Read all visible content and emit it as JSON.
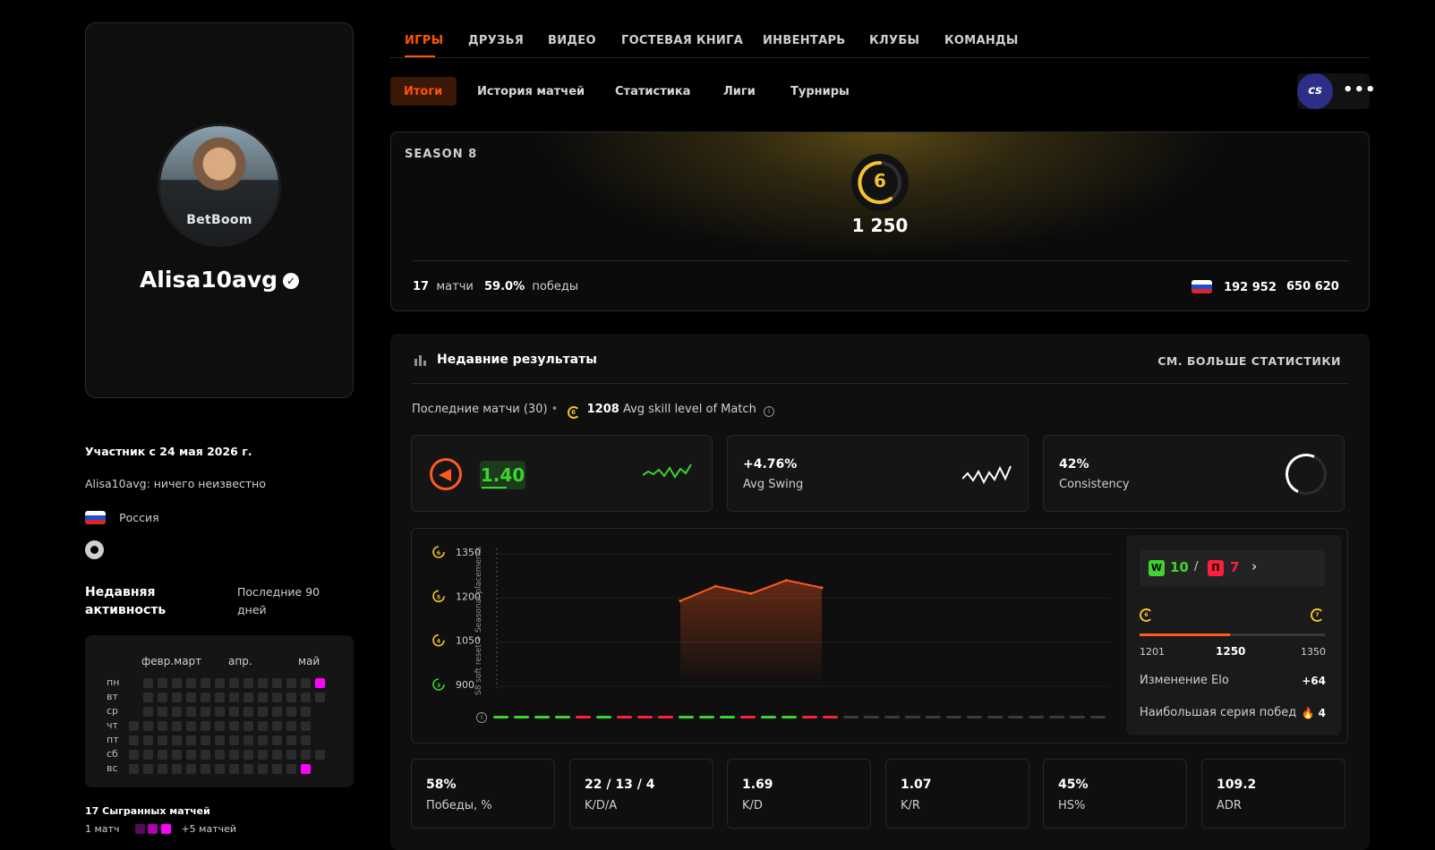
{
  "profile": {
    "username": "Alisa10avg",
    "avatar_shirt_text": "BetBoom",
    "member_since": "Участник с 24 мая 2026 г.",
    "bio": "Alisa10avg: ничего неизвестно",
    "country": "Россия"
  },
  "activity": {
    "title": "Недавняя активность",
    "period": "Последние 90 дней",
    "months": [
      "февр.март",
      "апр.",
      "май"
    ],
    "days": [
      "пн",
      "вт",
      "ср",
      "чт",
      "пт",
      "сб",
      "вс"
    ],
    "matches_played": "17 Сыгранных матчей",
    "legend_min": "1 матч",
    "legend_max": "+5 матчей"
  },
  "tabs": [
    "ИГРЫ",
    "ДРУЗЬЯ",
    "ВИДЕО",
    "ГОСТЕВАЯ КНИГА",
    "ИНВЕНТАРЬ",
    "КЛУБЫ",
    "КОМАНДЫ"
  ],
  "subtabs": [
    "Итоги",
    "История матчей",
    "Статистика",
    "Лиги",
    "Турниры"
  ],
  "game_icon_label": "cs",
  "season": {
    "title": "SEASON 8",
    "level": "6",
    "elo": "1 250",
    "matches_value": "17",
    "matches_label": "матчи",
    "winrate_value": "59.0%",
    "winrate_label": "победы",
    "country_rank": "192 952",
    "global_rank": "650 620"
  },
  "recent": {
    "title": "Недавние результаты",
    "more_link": "СМ. БОЛЬШЕ СТАТИСТИКИ",
    "last_matches": "Последние матчи (30)",
    "avg_level": "6",
    "avg_skill_value": "1208",
    "avg_skill_label": "Avg skill level of Match"
  },
  "kpis": {
    "rating": "1.40",
    "swing_value": "+4.76%",
    "swing_label": "Avg Swing",
    "consistency_value": "42%",
    "consistency_label": "Consistency"
  },
  "chart_data": {
    "type": "area",
    "title": "",
    "y_ticks": [
      {
        "value": 1350,
        "label": "1350",
        "level": "6"
      },
      {
        "value": 1200,
        "label": "1200",
        "level": "5"
      },
      {
        "value": 1050,
        "label": "1050",
        "level": "4"
      },
      {
        "value": 900,
        "label": "900",
        "level": "3"
      }
    ],
    "ylim": [
      900,
      1350
    ],
    "x": [
      1,
      2,
      3,
      4,
      5
    ],
    "values": [
      1190,
      1240,
      1215,
      1260,
      1235
    ],
    "note": "S8 soft reset + Seasonal placements",
    "results": [
      "W",
      "W",
      "W",
      "W",
      "L",
      "W",
      "L",
      "L",
      "L",
      "W",
      "W",
      "W",
      "L",
      "W",
      "W",
      "L",
      "L",
      "-",
      "-",
      "-",
      "-",
      "-",
      "-",
      "-",
      "-",
      "-",
      "-",
      "-",
      "-",
      "-"
    ]
  },
  "side": {
    "wins_badge": "W",
    "wins": "10",
    "losses_badge": "П",
    "losses": "7",
    "level_from": "6",
    "level_to": "7",
    "elo_min": "1201",
    "elo_current": "1250",
    "elo_max": "1350",
    "elo_progress": 0.49,
    "elo_change_label": "Изменение Elo",
    "elo_change_value": "+64",
    "streak_label": "Наибольшая серия побед",
    "streak_value": "4"
  },
  "stats": [
    {
      "value": "58%",
      "label": "Победы, %"
    },
    {
      "value": "22 / 13 / 4",
      "label": "K/D/A"
    },
    {
      "value": "1.69",
      "label": "K/D"
    },
    {
      "value": "1.07",
      "label": "K/R"
    },
    {
      "value": "45%",
      "label": "HS%"
    },
    {
      "value": "109.2",
      "label": "ADR"
    }
  ],
  "colors": {
    "accent": "#ff5500",
    "win": "#3bd52e",
    "loss": "#ff1f3d",
    "level": "#f2c230",
    "activity": "#ff00ff"
  }
}
